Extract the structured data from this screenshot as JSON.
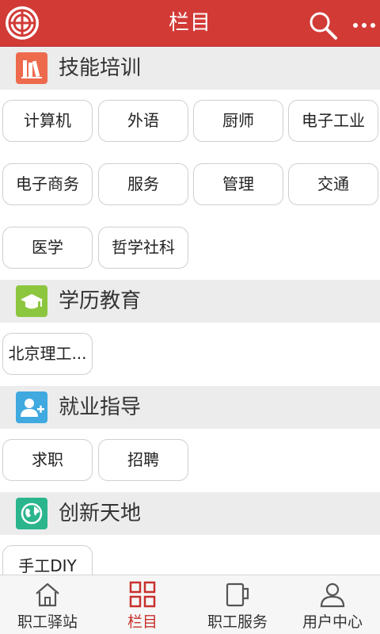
{
  "header": {
    "title": "栏目"
  },
  "sections": {
    "skills": {
      "title": "技能培训",
      "icon": "books-icon",
      "color": "#ee6a4d",
      "tags": [
        "计算机",
        "外语",
        "厨师",
        "电子工业",
        "电子商务",
        "服务",
        "管理",
        "交通",
        "医学",
        "哲学社科"
      ]
    },
    "education": {
      "title": "学历教育",
      "icon": "graduation-cap-icon",
      "color": "#8cc63f",
      "tags": [
        "北京理工..."
      ]
    },
    "employment": {
      "title": "就业指导",
      "icon": "add-user-icon",
      "color": "#3fa9e0",
      "tags": [
        "求职",
        "招聘"
      ]
    },
    "innovation": {
      "title": "创新天地",
      "icon": "globe-icon",
      "color": "#2ab58d",
      "tags": [
        "手工DIY"
      ]
    }
  },
  "tabs": [
    {
      "label": "职工驿站",
      "icon": "home-icon",
      "active": false
    },
    {
      "label": "栏目",
      "icon": "grid-icon",
      "active": true
    },
    {
      "label": "职工服务",
      "icon": "cup-icon",
      "active": false
    },
    {
      "label": "用户中心",
      "icon": "user-icon",
      "active": false
    }
  ],
  "colors": {
    "brand": "#d23a36",
    "active_tab": "#c8312d"
  }
}
